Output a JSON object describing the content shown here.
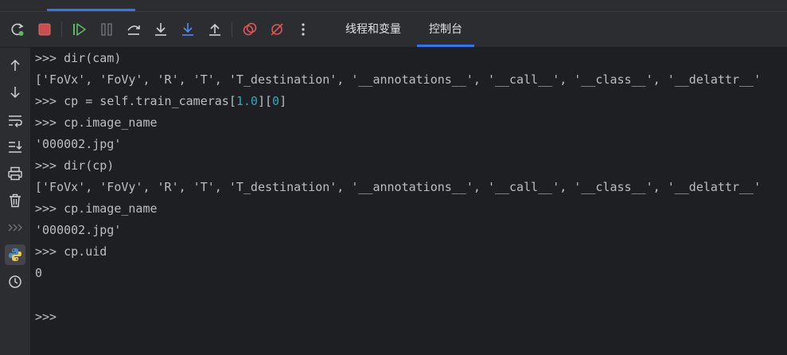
{
  "tabs": [
    {
      "label": "线程和变量"
    },
    {
      "label": "控制台"
    }
  ],
  "active_tab": "控制台",
  "toolbar_icons": [
    "rerun-icon",
    "stop-icon",
    "resume-icon",
    "pause-icon",
    "step-over-icon",
    "step-into-icon",
    "step-into-my-code-icon",
    "step-out-icon",
    "view-breakpoints-icon",
    "mute-breakpoints-icon",
    "more-icon"
  ],
  "sidebar_icons": [
    "scroll-up-icon",
    "scroll-down-icon",
    "soft-wrap-icon",
    "scroll-to-end-icon",
    "print-icon",
    "clear-all-icon",
    "expand-icon",
    "python-console-icon",
    "history-icon"
  ],
  "console": {
    "lines": [
      {
        "pre": ">>> dir(cam)"
      },
      {
        "pre": "['FoVx', 'FoVy', 'R', 'T', 'T_destination', '__annotations__', '__call__', '__class__', '__delattr__'"
      },
      {
        "pre": ">>> cp = self.train_cameras[",
        "n1": "1.0",
        "mid": "][",
        "n2": "0",
        "post": "]"
      },
      {
        "pre": ">>> cp.image_name"
      },
      {
        "pre": "'000002.jpg'"
      },
      {
        "pre": ">>> dir(cp)"
      },
      {
        "pre": "['FoVx', 'FoVy', 'R', 'T', 'T_destination', '__annotations__', '__call__', '__class__', '__delattr__'"
      },
      {
        "pre": ">>> cp.image_name"
      },
      {
        "pre": "'000002.jpg'"
      },
      {
        "pre": ">>> cp.uid"
      },
      {
        "pre": "0"
      },
      {
        "pre": ""
      },
      {
        "pre": ">>>"
      }
    ]
  },
  "colors": {
    "background": "#1e1f22",
    "toolbar": "#2b2d30",
    "accent": "#3574f0",
    "text": "#bcbec4",
    "number": "#2aacb8",
    "green": "#5fb865",
    "red": "#e05555"
  }
}
